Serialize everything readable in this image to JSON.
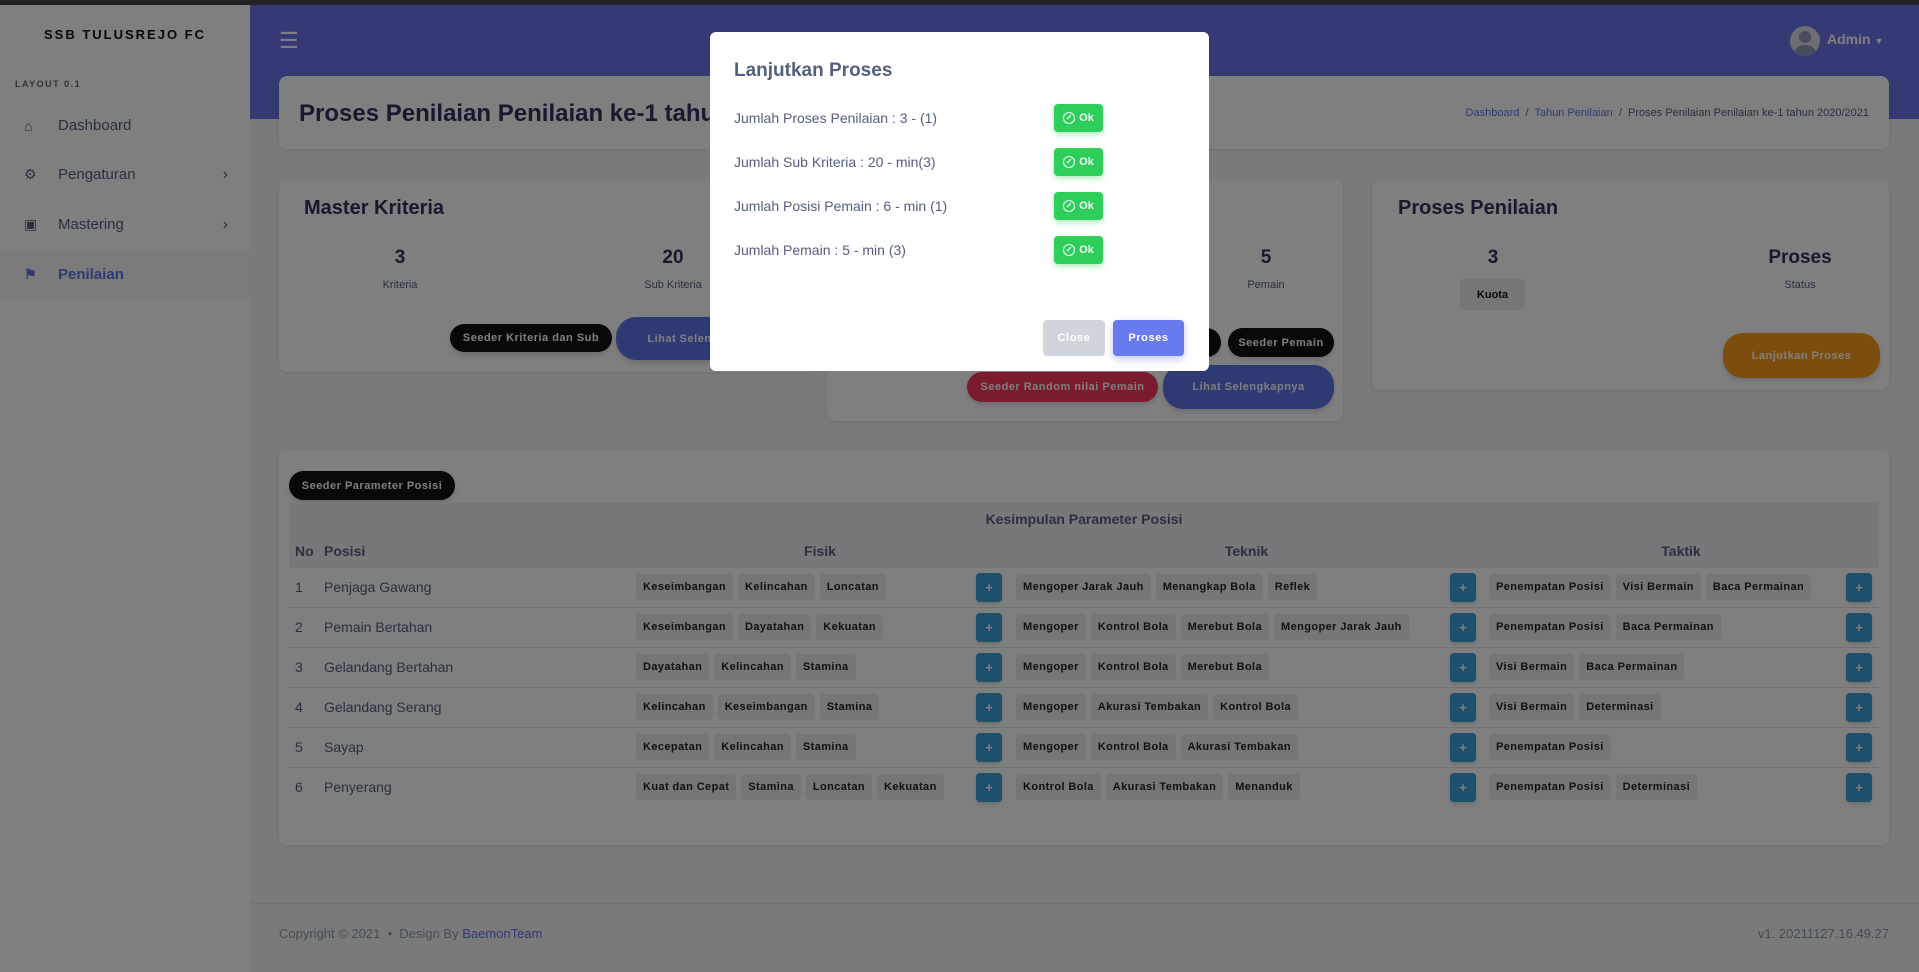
{
  "sidebar": {
    "brand": "SSB TULUSREJO FC",
    "section_label": "LAYOUT 0.1",
    "items": [
      {
        "label": "Dashboard",
        "icon": "home-icon",
        "active": false,
        "has_children": false
      },
      {
        "label": "Pengaturan",
        "icon": "gear-icon",
        "active": false,
        "has_children": true
      },
      {
        "label": "Mastering",
        "icon": "archive-icon",
        "active": false,
        "has_children": true
      },
      {
        "label": "Penilaian",
        "icon": "flag-checkered-icon",
        "active": true,
        "has_children": false
      }
    ]
  },
  "header": {
    "user": "Admin"
  },
  "page": {
    "title": "Proses Penilaian Penilaian ke-1 tahun 2020/2021",
    "breadcrumb": [
      "Dashboard",
      "Tahun Penilaian",
      "Proses Penilaian Penilaian ke-1 tahun 2020/2021"
    ]
  },
  "master_kriteria": {
    "title": "Master Kriteria",
    "stats": [
      {
        "value": "3",
        "label": "Kriteria"
      },
      {
        "value": "20",
        "label": "Sub Kriteria"
      }
    ],
    "seeder_button": "Seeder Kriteria dan Sub",
    "more_button": "Lihat Selengkapnya"
  },
  "pemain_card": {
    "stat": {
      "value": "5",
      "label": "Pemain"
    },
    "seeder_button": "Seeder Pemain",
    "random_button": "Seeder Random nilai Pemain",
    "more_button": "Lihat Selengkapnya"
  },
  "proses_card": {
    "title": "Proses Penilaian",
    "quota_value": "3",
    "quota_label": "Kuota",
    "status_value": "Proses",
    "status_label": "Status",
    "continue_button": "Lanjutkan Proses"
  },
  "parameter": {
    "seeder_button": "Seeder Parameter Posisi",
    "table_title": "Kesimpulan Parameter Posisi",
    "headers": {
      "no": "No",
      "posisi": "Posisi",
      "fisik": "Fisik",
      "teknik": "Teknik",
      "taktik": "Taktik"
    },
    "rows": [
      {
        "no": "1",
        "posisi": "Penjaga Gawang",
        "fisik": [
          "Keseimbangan",
          "Kelincahan",
          "Loncatan"
        ],
        "teknik": [
          "Mengoper Jarak Jauh",
          "Menangkap Bola",
          "Reflek"
        ],
        "taktik": [
          "Penempatan Posisi",
          "Visi Bermain",
          "Baca Permainan"
        ]
      },
      {
        "no": "2",
        "posisi": "Pemain Bertahan",
        "fisik": [
          "Keseimbangan",
          "Dayatahan",
          "Kekuatan"
        ],
        "teknik": [
          "Mengoper",
          "Kontrol Bola",
          "Merebut Bola",
          "Mengoper Jarak Jauh"
        ],
        "taktik": [
          "Penempatan Posisi",
          "Baca Permainan"
        ]
      },
      {
        "no": "3",
        "posisi": "Gelandang Bertahan",
        "fisik": [
          "Dayatahan",
          "Kelincahan",
          "Stamina"
        ],
        "teknik": [
          "Mengoper",
          "Kontrol Bola",
          "Merebut Bola"
        ],
        "taktik": [
          "Visi Bermain",
          "Baca Permainan"
        ]
      },
      {
        "no": "4",
        "posisi": "Gelandang Serang",
        "fisik": [
          "Kelincahan",
          "Keseimbangan",
          "Stamina"
        ],
        "teknik": [
          "Mengoper",
          "Akurasi Tembakan",
          "Kontrol Bola"
        ],
        "taktik": [
          "Visi Bermain",
          "Determinasi"
        ]
      },
      {
        "no": "5",
        "posisi": "Sayap",
        "fisik": [
          "Kecepatan",
          "Kelincahan",
          "Stamina"
        ],
        "teknik": [
          "Mengoper",
          "Kontrol Bola",
          "Akurasi Tembakan"
        ],
        "taktik": [
          "Penempatan Posisi"
        ]
      },
      {
        "no": "6",
        "posisi": "Penyerang",
        "fisik": [
          "Kuat dan Cepat",
          "Stamina",
          "Loncatan",
          "Kekuatan"
        ],
        "teknik": [
          "Kontrol Bola",
          "Akurasi Tembakan",
          "Menanduk"
        ],
        "taktik": [
          "Penempatan Posisi",
          "Determinasi"
        ]
      }
    ]
  },
  "footer": {
    "copyright": "Copyright © 2021  •  Design By ",
    "team": "BaemonTeam",
    "version": "v1. 20211127.16.49.27"
  },
  "modal": {
    "title": "Lanjutkan Proses",
    "checks": [
      {
        "label": "Jumlah Proses Penilaian : 3 - (1)",
        "status": "Ok"
      },
      {
        "label": "Jumlah Sub Kriteria : 20 - min(3)",
        "status": "Ok"
      },
      {
        "label": "Jumlah Posisi Pemain : 6 - min (1)",
        "status": "Ok"
      },
      {
        "label": "Jumlah Pemain : 5 - min (3)",
        "status": "Ok"
      }
    ],
    "close_button": "Close",
    "submit_button": "Proses"
  },
  "colors": {
    "primary": "#5e72e4",
    "header": "#6a75e8",
    "success": "#2dce5a",
    "danger": "#f5365c",
    "warning": "#fb9a1a",
    "info": "#3aa0db"
  }
}
